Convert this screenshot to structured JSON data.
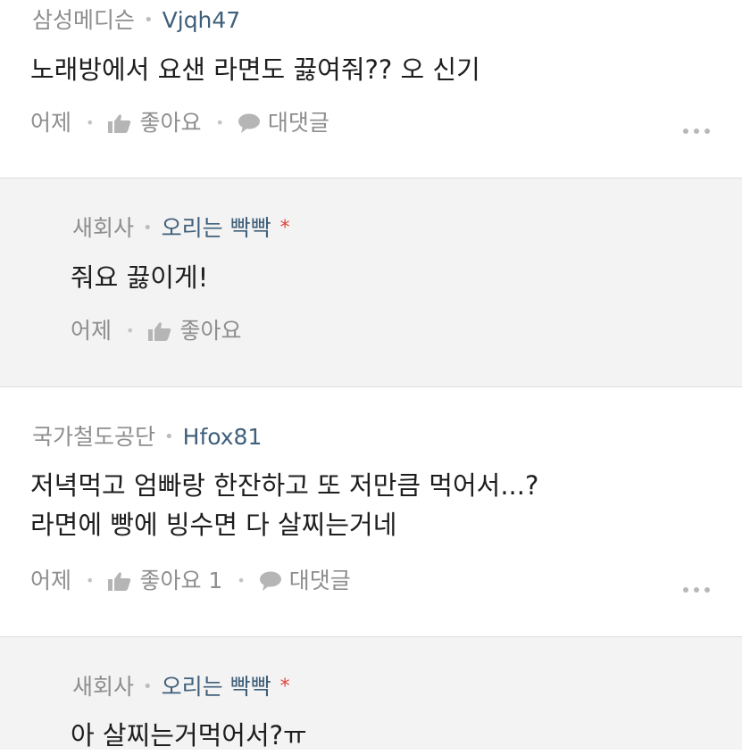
{
  "comments": [
    {
      "company": "삼성메디슨",
      "nickname": "Vjqh47",
      "text_lines": [
        "노래방에서 요샌 라면도 끓여줘?? 오 신기"
      ],
      "time": "어제",
      "like_label": "좋아요",
      "reply_label": "대댓글"
    },
    {
      "company": "새회사",
      "nickname": "오리는 빡빡",
      "writer_mark": "*",
      "text_lines": [
        "줘요 끓이게!"
      ],
      "time": "어제",
      "like_label": "좋아요"
    },
    {
      "company": "국가철도공단",
      "nickname": "Hfox81",
      "text_lines": [
        "저녁먹고 엄빠랑 한잔하고 또 저만큼 먹어서...?",
        "라면에 빵에 빙수면 다 살찌는거네"
      ],
      "time": "어제",
      "like_label": "좋아요 1",
      "reply_label": "대댓글"
    },
    {
      "company": "새회사",
      "nickname": "오리는 빡빡",
      "writer_mark": "*",
      "text_lines": [
        "아 살찌는거먹어서?ㅠ"
      ]
    }
  ],
  "colors": {
    "reply_background": "#f3f3f3",
    "nickname": "#3f5f7a",
    "writer_mark": "#e0453c",
    "meta_gray": "#8e8e8e"
  },
  "icons": {
    "like": "thumbs-up-icon",
    "reply": "speech-bubble-icon",
    "more": "more-dots-icon"
  }
}
